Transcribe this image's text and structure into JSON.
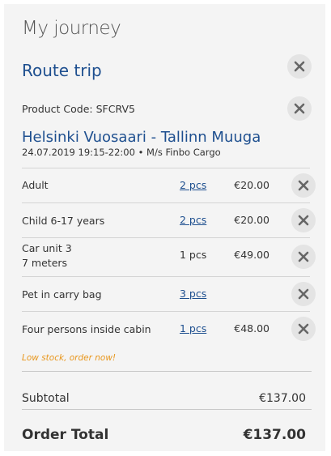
{
  "header": {
    "title": "My journey"
  },
  "route": {
    "title": "Route trip"
  },
  "product": {
    "code_label": "Product Code: SFCRV5",
    "trip_name": "Helsinki Vuosaari - Tallinn Muuga",
    "trip_meta": "24.07.2019 19:15-22:00 • M/s Finbo Cargo"
  },
  "items": [
    {
      "label": "Adult",
      "qty": "2 pcs",
      "price": "€20.00"
    },
    {
      "label": "Child 6-17 years",
      "qty": "2 pcs",
      "price": "€20.00"
    },
    {
      "label": "Car unit 3",
      "sublabel": "7 meters",
      "qty": "1 pcs",
      "price": "€49.00"
    },
    {
      "label": "Pet in carry bag",
      "qty": "3 pcs",
      "price": ""
    },
    {
      "label": "Four persons inside cabin",
      "qty": "1 pcs",
      "price": "€48.00"
    }
  ],
  "stock_notice": "Low stock, order now!",
  "summary": {
    "subtotal_label": "Subtotal",
    "subtotal_value": "€137.00",
    "total_label": "Order Total",
    "total_value": "€137.00"
  },
  "colors": {
    "accent": "#1e4f8f",
    "warning": "#e8961b",
    "panel": "#f4f4f4"
  },
  "icons": {
    "remove": "close-icon"
  }
}
